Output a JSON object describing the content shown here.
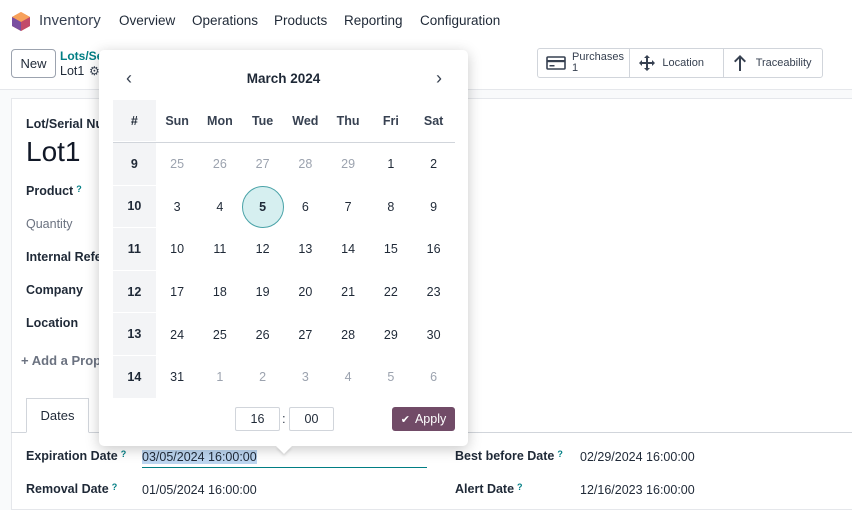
{
  "topbar": {
    "app_name": "Inventory",
    "menu": [
      "Overview",
      "Operations",
      "Products",
      "Reporting",
      "Configuration"
    ]
  },
  "control": {
    "new_label": "New",
    "breadcrumb_parent": "Lots/Se",
    "breadcrumb_current": "Lot1",
    "gear_icon": "gear-icon",
    "stats": {
      "purchases_label": "Purchases",
      "purchases_count": "1",
      "location_label": "Location",
      "traceability_label": "Traceability"
    }
  },
  "form": {
    "lot_label": "Lot/Serial Nu",
    "lot_name": "Lot1",
    "product_label": "Product",
    "quantity_label": "Quantity",
    "internal_ref_label": "Internal Refe",
    "company_label": "Company",
    "location_label": "Location",
    "add_property": "Add a Prop",
    "tab_dates": "Dates",
    "expiration_label": "Expiration Date",
    "expiration_value": "03/05/2024 16:00:00",
    "removal_label": "Removal Date",
    "removal_value": "01/05/2024 16:00:00",
    "best_before_label": "Best before Date",
    "best_before_value": "02/29/2024 16:00:00",
    "alert_label": "Alert Date",
    "alert_value": "12/16/2023 16:00:00",
    "help_mark": "?"
  },
  "datepicker": {
    "month_title": "March 2024",
    "header": [
      "#",
      "Sun",
      "Mon",
      "Tue",
      "Wed",
      "Thu",
      "Fri",
      "Sat"
    ],
    "weeks": [
      {
        "week": "9",
        "days": [
          "25",
          "26",
          "27",
          "28",
          "29",
          "1",
          "2"
        ],
        "other": [
          true,
          true,
          true,
          true,
          true,
          false,
          false
        ]
      },
      {
        "week": "10",
        "days": [
          "3",
          "4",
          "5",
          "6",
          "7",
          "8",
          "9"
        ],
        "other": [
          false,
          false,
          false,
          false,
          false,
          false,
          false
        ]
      },
      {
        "week": "11",
        "days": [
          "10",
          "11",
          "12",
          "13",
          "14",
          "15",
          "16"
        ],
        "other": [
          false,
          false,
          false,
          false,
          false,
          false,
          false
        ]
      },
      {
        "week": "12",
        "days": [
          "17",
          "18",
          "19",
          "20",
          "21",
          "22",
          "23"
        ],
        "other": [
          false,
          false,
          false,
          false,
          false,
          false,
          false
        ]
      },
      {
        "week": "13",
        "days": [
          "24",
          "25",
          "26",
          "27",
          "28",
          "29",
          "30"
        ],
        "other": [
          false,
          false,
          false,
          false,
          false,
          false,
          false
        ]
      },
      {
        "week": "14",
        "days": [
          "31",
          "1",
          "2",
          "3",
          "4",
          "5",
          "6"
        ],
        "other": [
          false,
          true,
          true,
          true,
          true,
          true,
          true
        ]
      }
    ],
    "selected_day": "5",
    "hour": "16",
    "minute": "00",
    "time_separator": ":",
    "apply_label": "Apply",
    "accent_color": "#714b67",
    "selected_color": "#d6eff0"
  }
}
